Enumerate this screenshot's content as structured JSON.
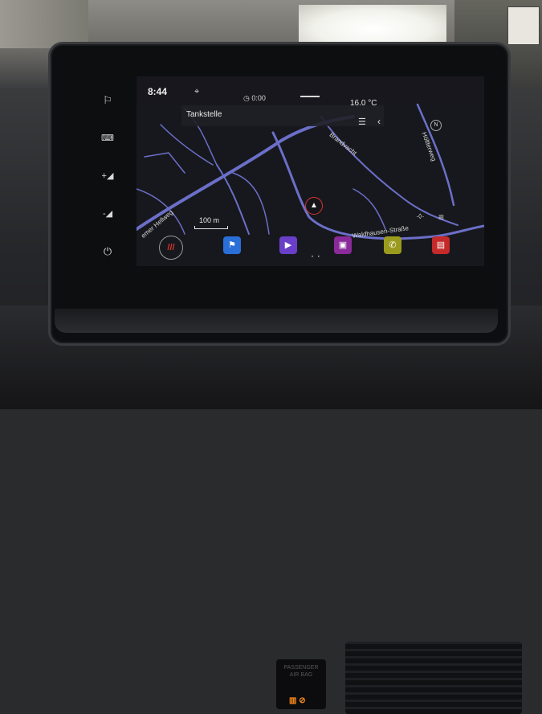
{
  "status": {
    "time": "8:44",
    "timer": "0:00",
    "temperature": "16.0 °C"
  },
  "map": {
    "search_label": "Tankstelle",
    "scale_label": "100 m",
    "roads": [
      "Brandvacht",
      "Höltlerweg",
      "Waldhausen-Straße",
      "emer Hellweg"
    ]
  },
  "side_buttons": [
    "flag-icon",
    "keyboard-icon",
    "volume-up-icon",
    "volume-down-icon",
    "power-icon"
  ],
  "dock": {
    "apps": [
      "home-icon",
      "navigation-icon",
      "media-icon",
      "radio-icon",
      "phone-icon",
      "messages-icon"
    ],
    "page_dots": "• •"
  },
  "dashboard": {
    "passenger_label": "PASSENGER\nAIR BAG"
  },
  "colors": {
    "accent": "#d8352d",
    "nav_blue": "#2a6ed8",
    "media_purple": "#6a3fc8",
    "radio_purple": "#8a2a9a",
    "phone_olive": "#9a9a1e",
    "message_red": "#c42a2a",
    "road": "#6b6fc8"
  }
}
